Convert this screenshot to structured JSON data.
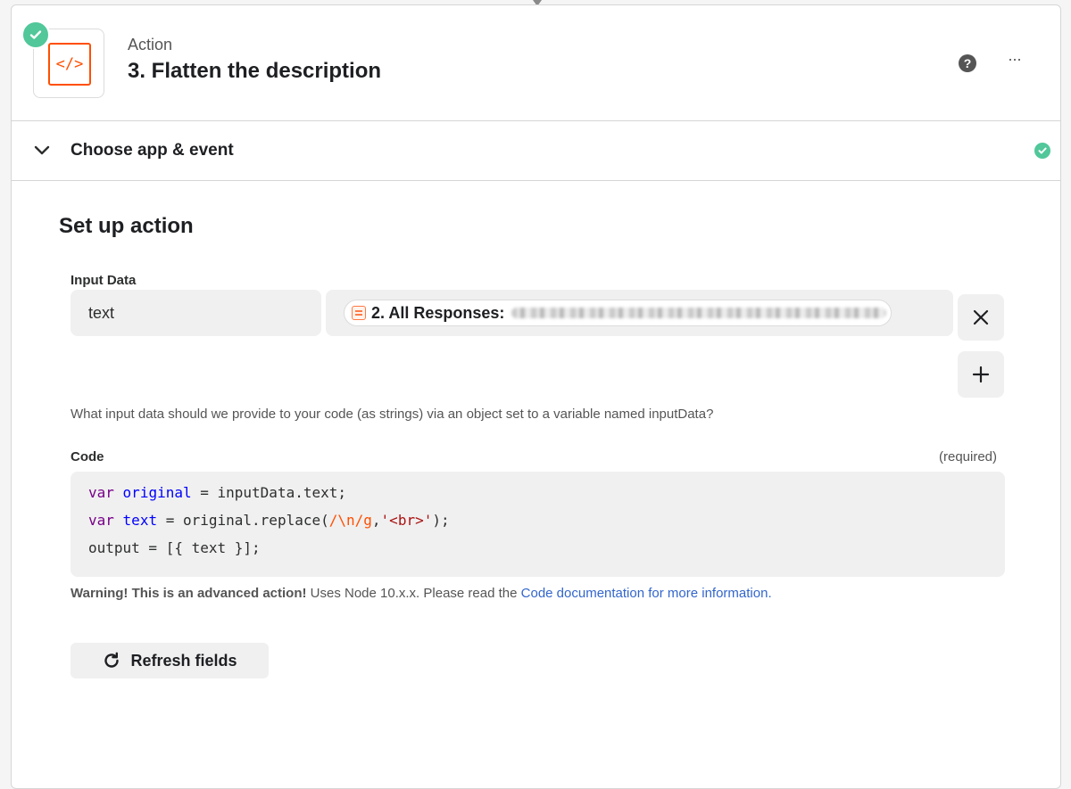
{
  "step": {
    "kind": "Action",
    "title": "3. Flatten the description",
    "app_icon_glyph": "</>",
    "help_icon": "?",
    "more_icon": "···"
  },
  "section": {
    "title": "Choose app & event",
    "status": "complete"
  },
  "setup": {
    "title": "Set up action",
    "input_data_label": "Input Data",
    "input_key": "text",
    "input_value_pill": "2. All Responses:",
    "help_text": "What input data should we provide to your code (as strings) via an object set to a variable named inputData?",
    "code_label": "Code",
    "required_label": "(required)",
    "code_lines": [
      "var original = inputData.text;",
      "var text = original.replace(/\\n/g,'<br>');",
      "output = [{ text }];"
    ],
    "warning_bold": "Warning! This is an advanced action!",
    "warning_text": " Uses Node 10.x.x. Please read the ",
    "warning_link": "Code documentation for more information",
    "warning_end": ".",
    "refresh_label": "Refresh fields"
  },
  "colors": {
    "success": "#51c79a",
    "brand": "#ff4f00",
    "link": "#3366cc"
  }
}
